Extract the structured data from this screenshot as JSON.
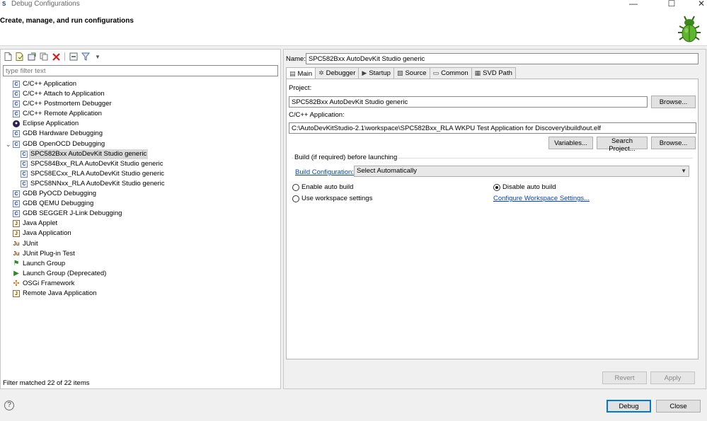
{
  "window": {
    "title": "Debug Configurations",
    "subtitle": "Create, manage, and run configurations",
    "app_icon_glyph": "S",
    "minimize_glyph": "—",
    "maximize_glyph": "☐",
    "close_glyph": "✕"
  },
  "left": {
    "filter_placeholder": "type filter text",
    "status": "Filter matched 22 of 22 items",
    "toolbar_icons": [
      "new-configuration-icon",
      "new-prototype-icon",
      "export-icon",
      "duplicate-icon",
      "delete-icon",
      "collapse-all-icon",
      "filter-icon",
      "view-menu-icon"
    ],
    "tree": [
      {
        "label": "C/C++ Application",
        "icon": "c-app-icon",
        "glyph": "C",
        "level": 0
      },
      {
        "label": "C/C++ Attach to Application",
        "icon": "c-app-icon",
        "glyph": "C",
        "level": 0
      },
      {
        "label": "C/C++ Postmortem Debugger",
        "icon": "c-app-icon",
        "glyph": "C",
        "level": 0
      },
      {
        "label": "C/C++ Remote Application",
        "icon": "c-app-icon",
        "glyph": "C",
        "level": 0
      },
      {
        "label": "Eclipse Application",
        "icon": "eclipse-icon",
        "glyph": "●",
        "level": 0
      },
      {
        "label": "GDB Hardware Debugging",
        "icon": "c-app-icon",
        "glyph": "C",
        "level": 0
      },
      {
        "label": "GDB OpenOCD Debugging",
        "icon": "c-app-icon",
        "glyph": "C",
        "level": 0,
        "expanded": true
      },
      {
        "label": "SPC582Bxx AutoDevKit Studio generic",
        "icon": "c-app-icon",
        "glyph": "C",
        "level": 1,
        "selected": true
      },
      {
        "label": "SPC584Bxx_RLA AutoDevKit Studio generic",
        "icon": "c-app-icon",
        "glyph": "C",
        "level": 1
      },
      {
        "label": "SPC58ECxx_RLA AutoDevKit Studio generic",
        "icon": "c-app-icon",
        "glyph": "C",
        "level": 1
      },
      {
        "label": "SPC58NNxx_RLA AutoDevKit Studio generic",
        "icon": "c-app-icon",
        "glyph": "C",
        "level": 1
      },
      {
        "label": "GDB PyOCD Debugging",
        "icon": "c-app-icon",
        "glyph": "C",
        "level": 0
      },
      {
        "label": "GDB QEMU Debugging",
        "icon": "c-app-icon",
        "glyph": "C",
        "level": 0
      },
      {
        "label": "GDB SEGGER J-Link Debugging",
        "icon": "c-app-icon",
        "glyph": "C",
        "level": 0
      },
      {
        "label": "Java Applet",
        "icon": "java-applet-icon",
        "glyph": "J",
        "level": 0
      },
      {
        "label": "Java Application",
        "icon": "java-app-icon",
        "glyph": "J",
        "level": 0
      },
      {
        "label": "JUnit",
        "icon": "junit-icon",
        "glyph": "Ju",
        "level": 0
      },
      {
        "label": "JUnit Plug-in Test",
        "icon": "junit-plugin-icon",
        "glyph": "Ju",
        "level": 0
      },
      {
        "label": "Launch Group",
        "icon": "launch-group-icon",
        "glyph": "⚑",
        "level": 0
      },
      {
        "label": "Launch Group (Deprecated)",
        "icon": "launch-deprecated-icon",
        "glyph": "▶",
        "level": 0
      },
      {
        "label": "OSGi Framework",
        "icon": "osgi-icon",
        "glyph": "✣",
        "level": 0
      },
      {
        "label": "Remote Java Application",
        "icon": "remote-java-icon",
        "glyph": "J",
        "level": 0
      }
    ]
  },
  "right": {
    "name_label": "Name:",
    "name_value": "SPC582Bxx AutoDevKit Studio generic",
    "tabs": [
      {
        "label": "Main",
        "icon": "main-tab-icon",
        "glyph": "▤",
        "active": true
      },
      {
        "label": "Debugger",
        "icon": "debugger-tab-icon",
        "glyph": "✲"
      },
      {
        "label": "Startup",
        "icon": "startup-tab-icon",
        "glyph": "▶"
      },
      {
        "label": "Source",
        "icon": "source-tab-icon",
        "glyph": "▧"
      },
      {
        "label": "Common",
        "icon": "common-tab-icon",
        "glyph": "▭"
      },
      {
        "label": "SVD Path",
        "icon": "svd-tab-icon",
        "glyph": "▦"
      }
    ],
    "project_label": "Project:",
    "project_value": "SPC582Bxx AutoDevKit Studio generic",
    "browse_label": "Browse...",
    "app_label": "C/C++ Application:",
    "app_value": "C:\\AutoDevKitStudio-2.1\\workspace\\SPC582Bxx_RLA WKPU Test Application for Discovery\\build\\out.elf",
    "variables_label": "Variables...",
    "search_project_label": "Search Project...",
    "browse2_label": "Browse...",
    "build_group_title": "Build (if required) before launching",
    "build_config_link": "Build Configuration:",
    "build_config_value": "Select Automatically",
    "enable_auto_build": "Enable auto build",
    "disable_auto_build": "Disable auto build",
    "use_workspace": "Use workspace settings",
    "configure_workspace_link": "Configure Workspace Settings...",
    "revert_label": "Revert",
    "apply_label": "Apply"
  },
  "footer": {
    "debug_label": "Debug",
    "close_label": "Close",
    "help_glyph": "?"
  }
}
